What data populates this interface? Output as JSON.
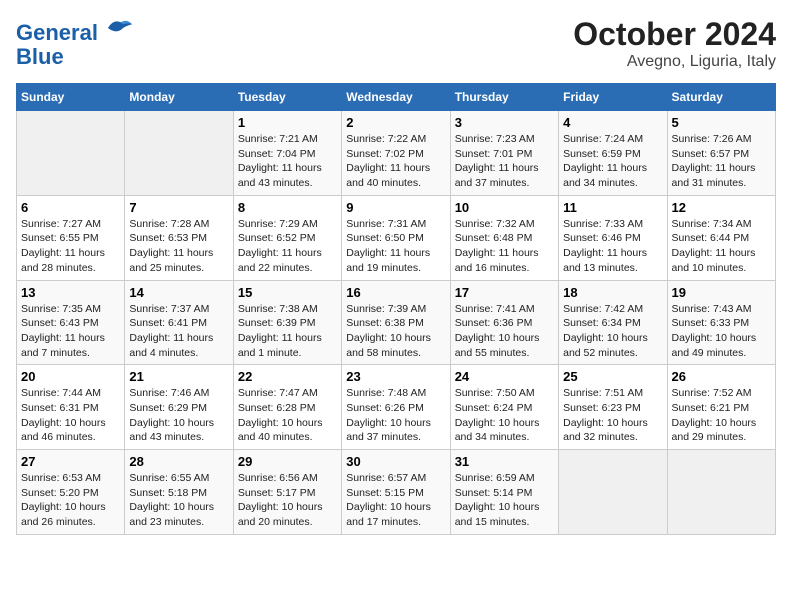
{
  "header": {
    "logo_line1": "General",
    "logo_line2": "Blue",
    "title": "October 2024",
    "subtitle": "Avegno, Liguria, Italy"
  },
  "calendar": {
    "weekdays": [
      "Sunday",
      "Monday",
      "Tuesday",
      "Wednesday",
      "Thursday",
      "Friday",
      "Saturday"
    ],
    "weeks": [
      [
        {
          "day": "",
          "info": ""
        },
        {
          "day": "",
          "info": ""
        },
        {
          "day": "1",
          "info": "Sunrise: 7:21 AM\nSunset: 7:04 PM\nDaylight: 11 hours and 43 minutes."
        },
        {
          "day": "2",
          "info": "Sunrise: 7:22 AM\nSunset: 7:02 PM\nDaylight: 11 hours and 40 minutes."
        },
        {
          "day": "3",
          "info": "Sunrise: 7:23 AM\nSunset: 7:01 PM\nDaylight: 11 hours and 37 minutes."
        },
        {
          "day": "4",
          "info": "Sunrise: 7:24 AM\nSunset: 6:59 PM\nDaylight: 11 hours and 34 minutes."
        },
        {
          "day": "5",
          "info": "Sunrise: 7:26 AM\nSunset: 6:57 PM\nDaylight: 11 hours and 31 minutes."
        }
      ],
      [
        {
          "day": "6",
          "info": "Sunrise: 7:27 AM\nSunset: 6:55 PM\nDaylight: 11 hours and 28 minutes."
        },
        {
          "day": "7",
          "info": "Sunrise: 7:28 AM\nSunset: 6:53 PM\nDaylight: 11 hours and 25 minutes."
        },
        {
          "day": "8",
          "info": "Sunrise: 7:29 AM\nSunset: 6:52 PM\nDaylight: 11 hours and 22 minutes."
        },
        {
          "day": "9",
          "info": "Sunrise: 7:31 AM\nSunset: 6:50 PM\nDaylight: 11 hours and 19 minutes."
        },
        {
          "day": "10",
          "info": "Sunrise: 7:32 AM\nSunset: 6:48 PM\nDaylight: 11 hours and 16 minutes."
        },
        {
          "day": "11",
          "info": "Sunrise: 7:33 AM\nSunset: 6:46 PM\nDaylight: 11 hours and 13 minutes."
        },
        {
          "day": "12",
          "info": "Sunrise: 7:34 AM\nSunset: 6:44 PM\nDaylight: 11 hours and 10 minutes."
        }
      ],
      [
        {
          "day": "13",
          "info": "Sunrise: 7:35 AM\nSunset: 6:43 PM\nDaylight: 11 hours and 7 minutes."
        },
        {
          "day": "14",
          "info": "Sunrise: 7:37 AM\nSunset: 6:41 PM\nDaylight: 11 hours and 4 minutes."
        },
        {
          "day": "15",
          "info": "Sunrise: 7:38 AM\nSunset: 6:39 PM\nDaylight: 11 hours and 1 minute."
        },
        {
          "day": "16",
          "info": "Sunrise: 7:39 AM\nSunset: 6:38 PM\nDaylight: 10 hours and 58 minutes."
        },
        {
          "day": "17",
          "info": "Sunrise: 7:41 AM\nSunset: 6:36 PM\nDaylight: 10 hours and 55 minutes."
        },
        {
          "day": "18",
          "info": "Sunrise: 7:42 AM\nSunset: 6:34 PM\nDaylight: 10 hours and 52 minutes."
        },
        {
          "day": "19",
          "info": "Sunrise: 7:43 AM\nSunset: 6:33 PM\nDaylight: 10 hours and 49 minutes."
        }
      ],
      [
        {
          "day": "20",
          "info": "Sunrise: 7:44 AM\nSunset: 6:31 PM\nDaylight: 10 hours and 46 minutes."
        },
        {
          "day": "21",
          "info": "Sunrise: 7:46 AM\nSunset: 6:29 PM\nDaylight: 10 hours and 43 minutes."
        },
        {
          "day": "22",
          "info": "Sunrise: 7:47 AM\nSunset: 6:28 PM\nDaylight: 10 hours and 40 minutes."
        },
        {
          "day": "23",
          "info": "Sunrise: 7:48 AM\nSunset: 6:26 PM\nDaylight: 10 hours and 37 minutes."
        },
        {
          "day": "24",
          "info": "Sunrise: 7:50 AM\nSunset: 6:24 PM\nDaylight: 10 hours and 34 minutes."
        },
        {
          "day": "25",
          "info": "Sunrise: 7:51 AM\nSunset: 6:23 PM\nDaylight: 10 hours and 32 minutes."
        },
        {
          "day": "26",
          "info": "Sunrise: 7:52 AM\nSunset: 6:21 PM\nDaylight: 10 hours and 29 minutes."
        }
      ],
      [
        {
          "day": "27",
          "info": "Sunrise: 6:53 AM\nSunset: 5:20 PM\nDaylight: 10 hours and 26 minutes."
        },
        {
          "day": "28",
          "info": "Sunrise: 6:55 AM\nSunset: 5:18 PM\nDaylight: 10 hours and 23 minutes."
        },
        {
          "day": "29",
          "info": "Sunrise: 6:56 AM\nSunset: 5:17 PM\nDaylight: 10 hours and 20 minutes."
        },
        {
          "day": "30",
          "info": "Sunrise: 6:57 AM\nSunset: 5:15 PM\nDaylight: 10 hours and 17 minutes."
        },
        {
          "day": "31",
          "info": "Sunrise: 6:59 AM\nSunset: 5:14 PM\nDaylight: 10 hours and 15 minutes."
        },
        {
          "day": "",
          "info": ""
        },
        {
          "day": "",
          "info": ""
        }
      ]
    ]
  }
}
